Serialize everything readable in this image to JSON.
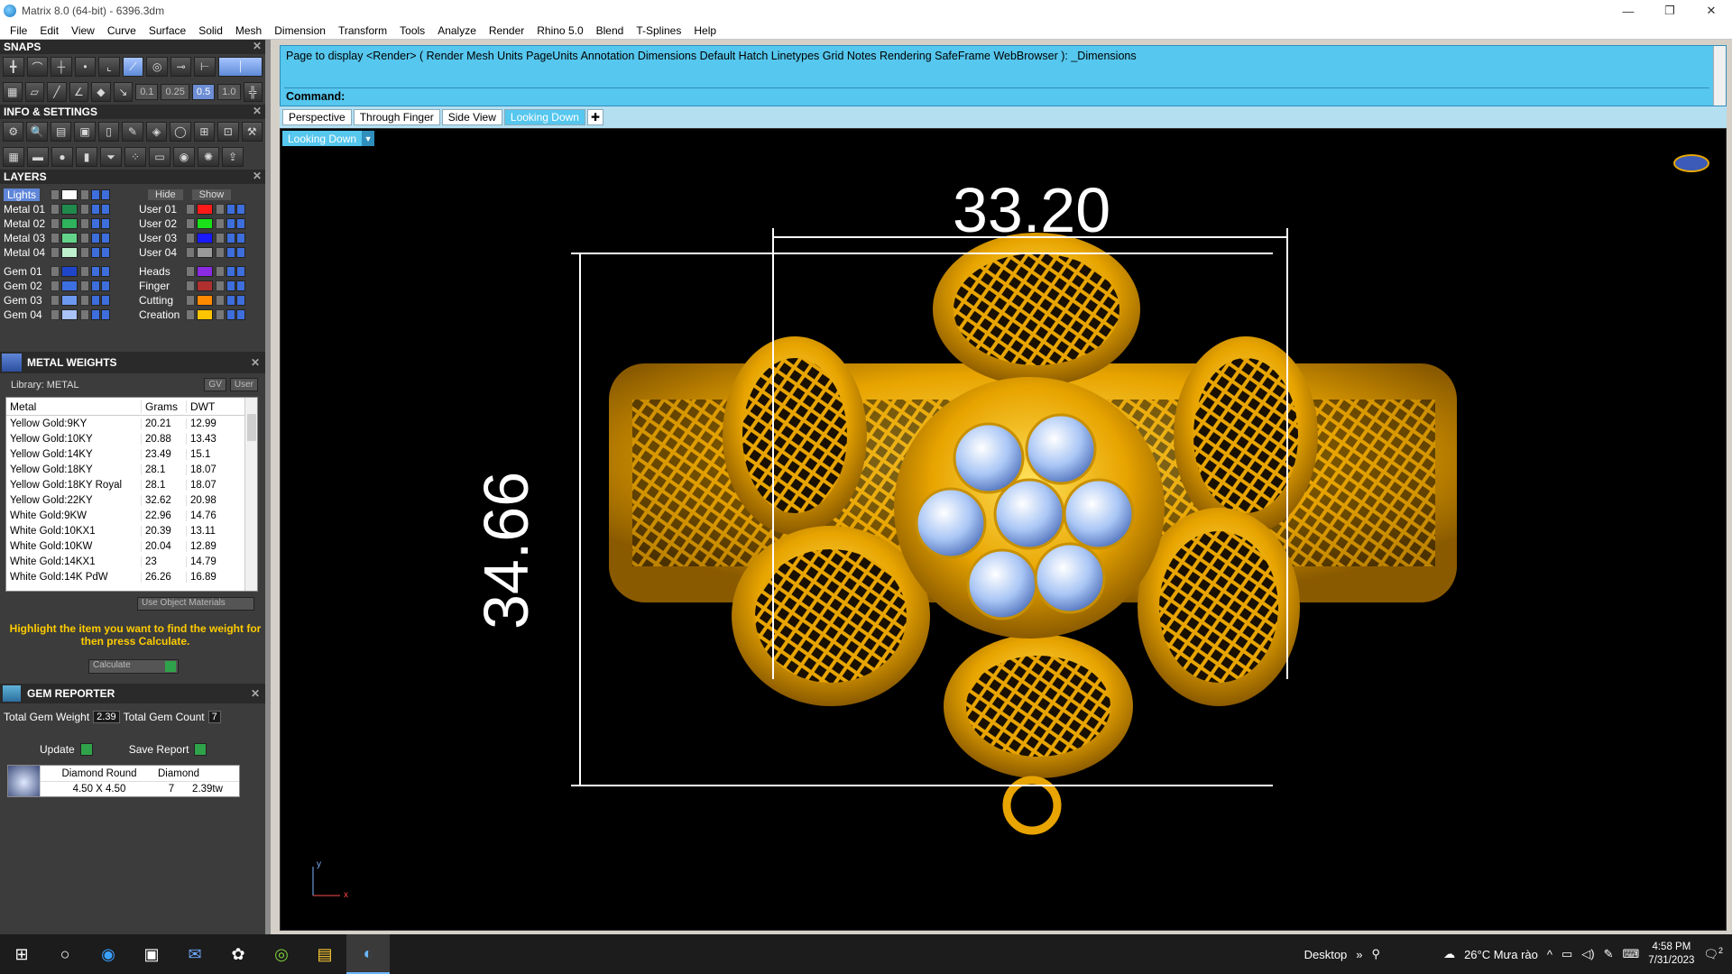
{
  "window": {
    "title": "Matrix 8.0 (64-bit) - 6396.3dm",
    "controls": [
      "—",
      "❐",
      "✕"
    ]
  },
  "menu": [
    "File",
    "Edit",
    "View",
    "Curve",
    "Surface",
    "Solid",
    "Mesh",
    "Dimension",
    "Transform",
    "Tools",
    "Analyze",
    "Render",
    "Rhino 5.0",
    "Blend",
    "T-Splines",
    "Help"
  ],
  "snaps": {
    "title": "SNAPS",
    "values": [
      "0.1",
      "0.25",
      "0.5",
      "1.0"
    ]
  },
  "info_settings": {
    "title": "INFO & SETTINGS"
  },
  "layers": {
    "title": "LAYERS",
    "hide_label": "Hide",
    "show_label": "Show",
    "left": [
      {
        "name": "Lights",
        "color": "#ffffff"
      },
      {
        "name": "Metal 01",
        "color": "#1f8a4c"
      },
      {
        "name": "Metal 02",
        "color": "#2fb35d"
      },
      {
        "name": "Metal 03",
        "color": "#63d38a"
      },
      {
        "name": "Metal 04",
        "color": "#bff0cd"
      },
      {
        "name": "Gem 01",
        "color": "#1f46c9"
      },
      {
        "name": "Gem 02",
        "color": "#3c6fe0"
      },
      {
        "name": "Gem 03",
        "color": "#6d98f0"
      },
      {
        "name": "Gem 04",
        "color": "#a9c3f7"
      }
    ],
    "right": [
      {
        "name": "User 01",
        "color": "#ff1a1a"
      },
      {
        "name": "User 02",
        "color": "#1ae01a"
      },
      {
        "name": "User 03",
        "color": "#1a1aff"
      },
      {
        "name": "User 04",
        "color": "#9a9a9a"
      },
      {
        "name": "Heads",
        "color": "#8a2be2"
      },
      {
        "name": "Finger",
        "color": "#b03030"
      },
      {
        "name": "Cutting",
        "color": "#ff8a00"
      },
      {
        "name": "Creation",
        "color": "#ffc400"
      }
    ]
  },
  "metal_weights": {
    "title": "METAL WEIGHTS",
    "library": "Library: METAL",
    "gv_label": "GV",
    "user_label": "User",
    "columns": [
      "Metal",
      "Grams",
      "DWT"
    ],
    "rows": [
      [
        "Yellow Gold:9KY",
        "20.21",
        "12.99"
      ],
      [
        "Yellow Gold:10KY",
        "20.88",
        "13.43"
      ],
      [
        "Yellow Gold:14KY",
        "23.49",
        "15.1"
      ],
      [
        "Yellow Gold:18KY",
        "28.1",
        "18.07"
      ],
      [
        "Yellow Gold:18KY Royal",
        "28.1",
        "18.07"
      ],
      [
        "Yellow Gold:22KY",
        "32.62",
        "20.98"
      ],
      [
        "White Gold:9KW",
        "22.96",
        "14.76"
      ],
      [
        "White Gold:10KX1",
        "20.39",
        "13.11"
      ],
      [
        "White Gold:10KW",
        "20.04",
        "12.89"
      ],
      [
        "White Gold:14KX1",
        "23",
        "14.79"
      ],
      [
        "White Gold:14K PdW",
        "26.26",
        "16.89"
      ]
    ],
    "use_object_materials": "Use Object Materials",
    "message": "Highlight the item you want to find the weight for then press Calculate.",
    "calculate": "Calculate"
  },
  "gem_reporter": {
    "title": "GEM REPORTER",
    "total_weight_label": "Total Gem Weight",
    "total_weight": "2.39",
    "total_count_label": "Total Gem Count",
    "total_count": "7",
    "update": "Update",
    "save_report": "Save Report",
    "gem": {
      "shape": "Diamond Round",
      "material": "Diamond",
      "size": "4.50 X 4.50",
      "count": "7",
      "weight": "2.39tw"
    }
  },
  "command": {
    "prompt_line": "Page to display <Render> ( Render  Mesh  Units  PageUnits  Annotation  Dimensions  Default  Hatch  Linetypes  Grid  Notes  Rendering  SafeFrame  WebBrowser ): _Dimensions",
    "label": "Command:"
  },
  "tabs": [
    "Perspective",
    "Through Finger",
    "Side View",
    "Looking Down"
  ],
  "active_tab": "Looking Down",
  "viewport": {
    "label": "Looking Down",
    "dim_horizontal": "33.20",
    "dim_vertical": "34.66",
    "axis_y": "y",
    "axis_x": "x"
  },
  "taskbar": {
    "desktop": "Desktop",
    "weather": "26°C  Mưa rào",
    "time": "4:58 PM",
    "date": "7/31/2023",
    "notifications": "2"
  }
}
